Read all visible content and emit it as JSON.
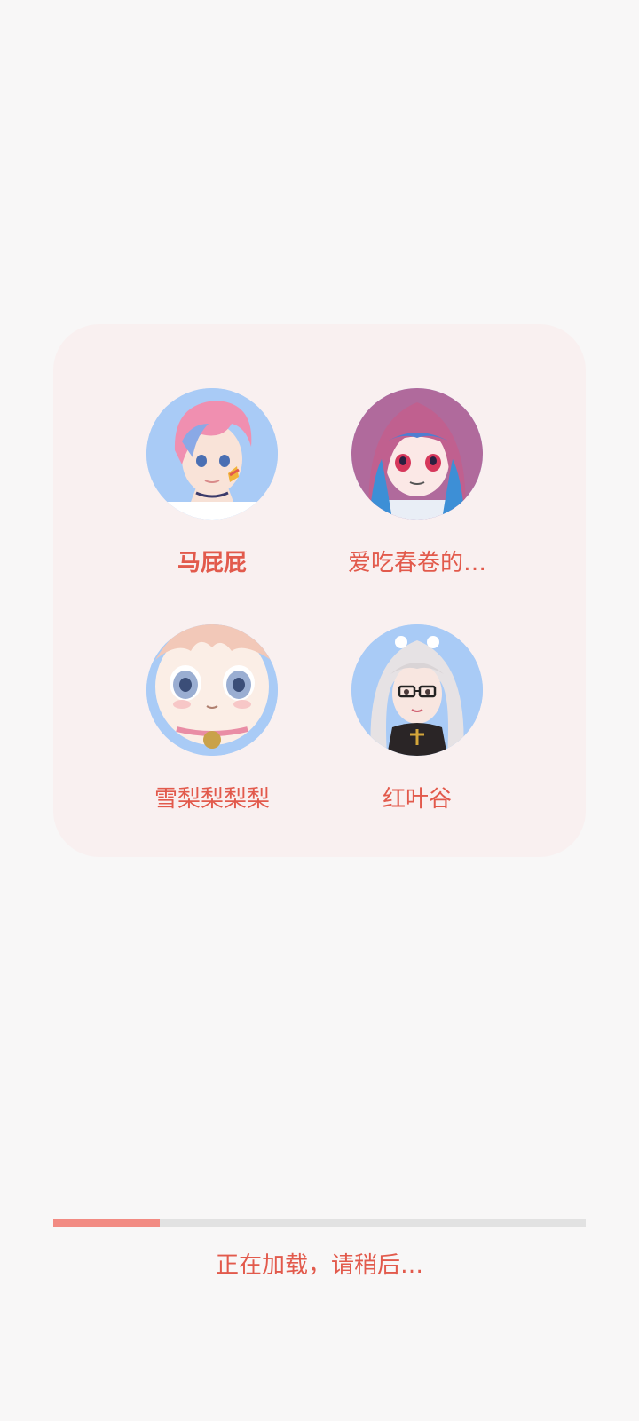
{
  "profiles": [
    {
      "name": "马屁屁",
      "selected": true,
      "avatar_icon": "character-avatar-pink-hair-boy"
    },
    {
      "name": "爱吃春卷的…",
      "selected": false,
      "avatar_icon": "character-avatar-blue-red-hair-girl"
    },
    {
      "name": "雪梨梨梨梨",
      "selected": false,
      "avatar_icon": "character-avatar-peach-hair-girl"
    },
    {
      "name": "红叶谷",
      "selected": false,
      "avatar_icon": "character-avatar-silver-hair-glasses-girl"
    }
  ],
  "loading": {
    "text": "正在加载，请稍后…",
    "progress": 0.2
  },
  "colors": {
    "accent_text": "#e25a4c",
    "progress_fill": "#f28b83",
    "progress_track": "#e2e2e2",
    "card_bg": "#f9f0f0",
    "avatar_bg": "#a9cbf6"
  }
}
